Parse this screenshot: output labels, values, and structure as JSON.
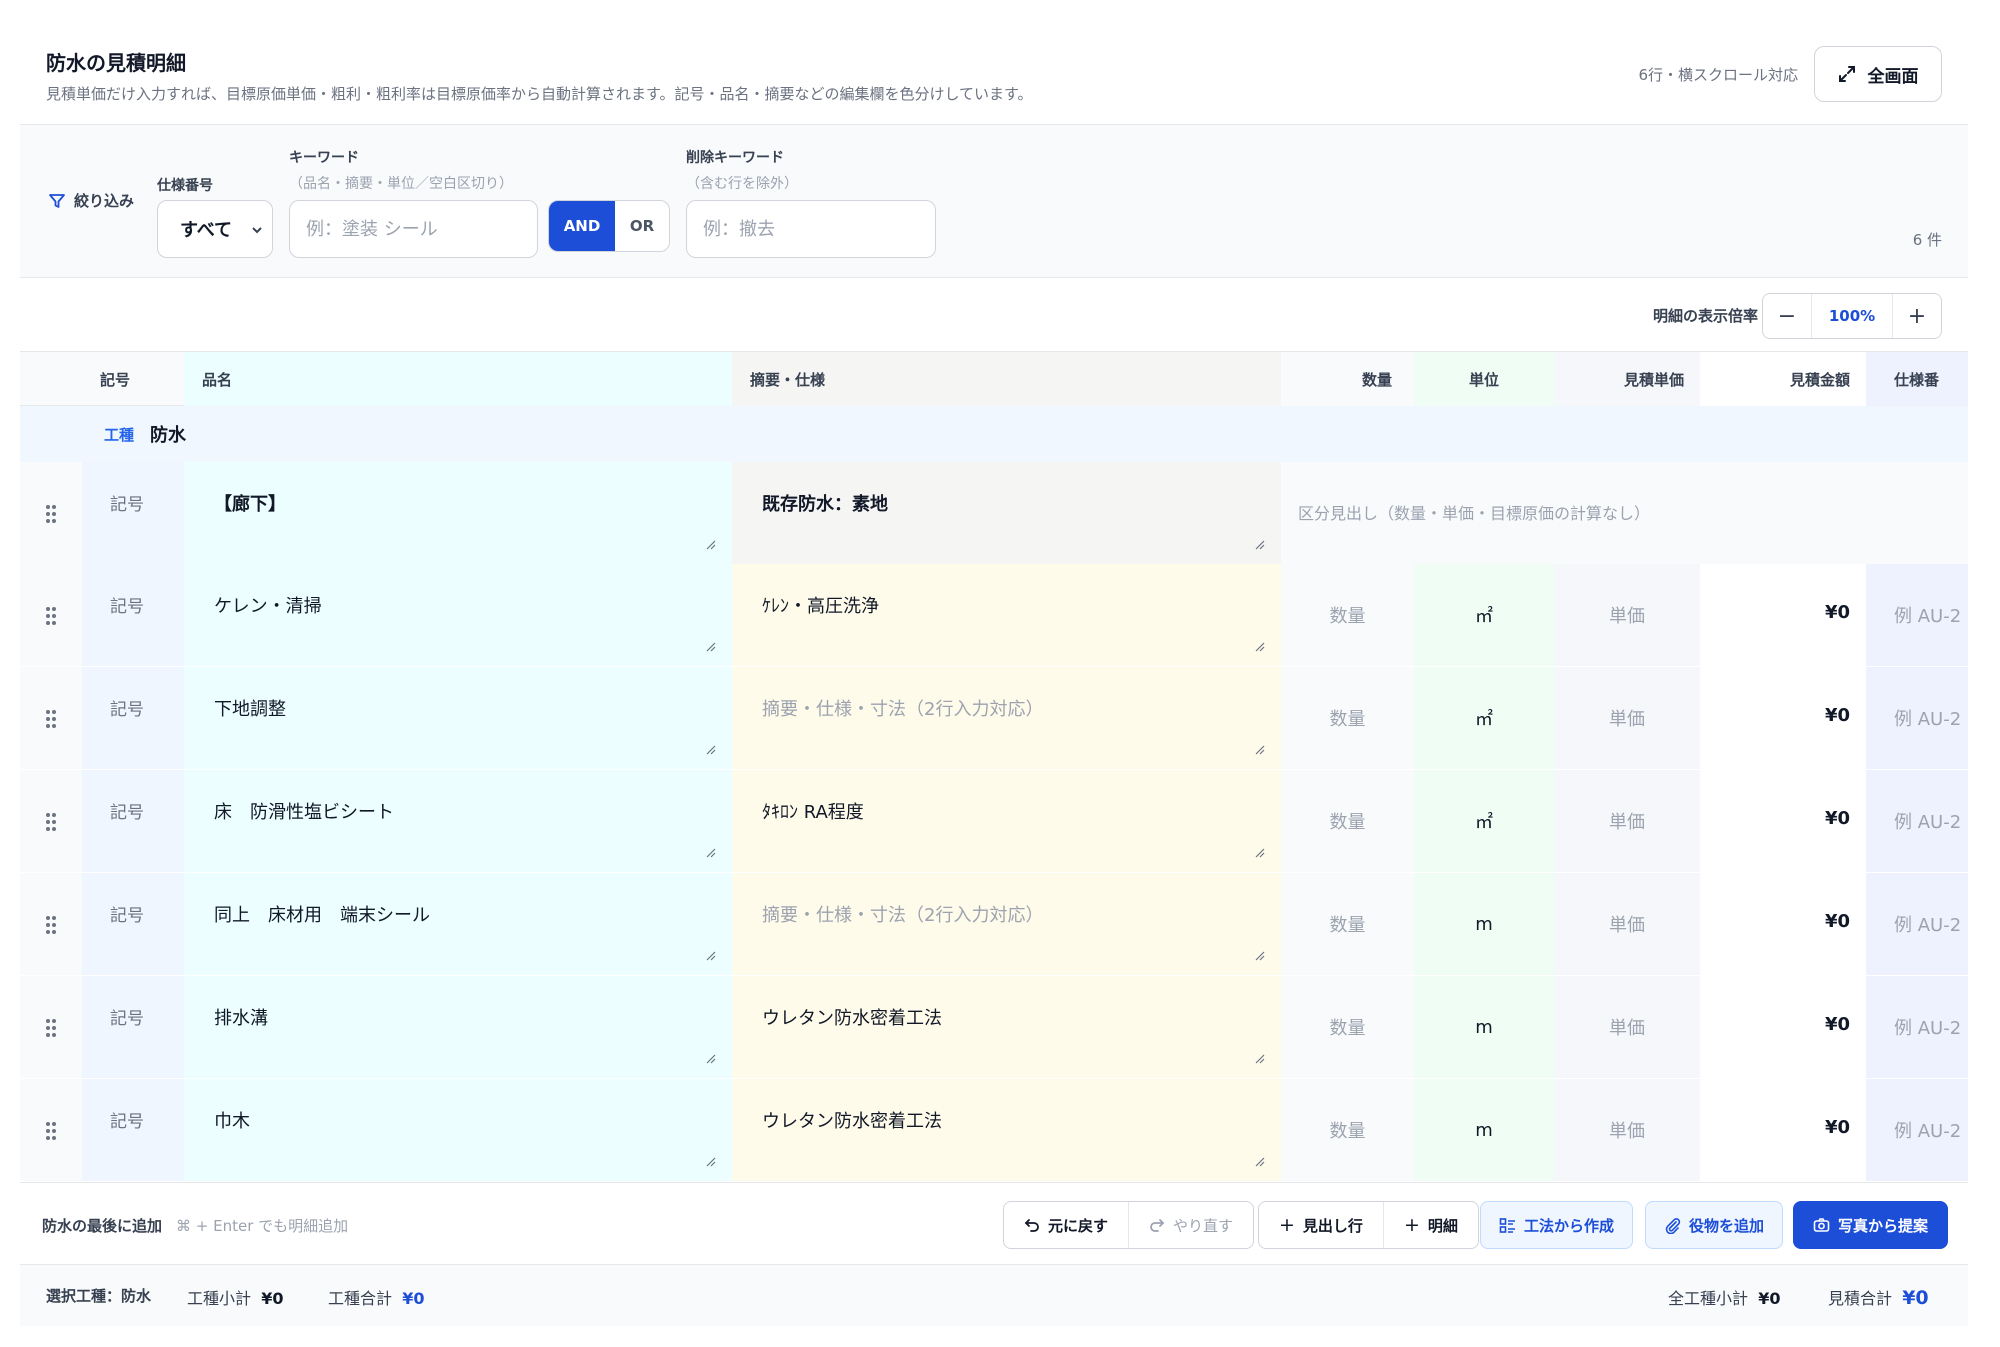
{
  "header": {
    "title": "防水の見積明細",
    "subtitle": "見積単価だけ入力すれば、目標原価単価・粗利・粗利率は目標原価率から自動計算されます。記号・品名・摘要などの編集欄を色分けしています。",
    "note": "6行・横スクロール対応",
    "fullscreen_label": "全画面"
  },
  "filter": {
    "label": "絞り込み",
    "spec_caption": "仕様番号",
    "spec_value": "すべて",
    "keyword_caption": "キーワード",
    "keyword_hint": "（品名・摘要・単位／空白区切り）",
    "keyword_placeholder": "例：塗装 シール",
    "and_label": "AND",
    "or_label": "OR",
    "exclude_caption": "削除キーワード",
    "exclude_hint": "（含む行を除外）",
    "exclude_placeholder": "例：撤去",
    "count": "6 件"
  },
  "zoom": {
    "label": "明細の表示倍率",
    "minus": "−",
    "value": "100%",
    "plus": "+"
  },
  "table": {
    "columns": {
      "code": "記号",
      "name": "品名",
      "memo": "摘要・仕様",
      "qty": "数量",
      "unit": "単位",
      "unit_price": "見積単価",
      "amount": "見積金額",
      "spec": "仕様番"
    },
    "group": {
      "tag": "工種",
      "name": "防水"
    },
    "heading_row": {
      "code": "記号",
      "name": "【廊下】",
      "memo": "既存防水：素地",
      "note": "区分見出し（数量・単価・目標原価の計算なし）"
    },
    "rows": [
      {
        "code": "記号",
        "name": "ケレン・清掃",
        "memo": "ｹﾚﾝ・高圧洗浄",
        "memo_placeholder": false,
        "qty": "数量",
        "unit": "㎡",
        "unit_price": "単価",
        "amount": "¥0",
        "spec": "例 AU-2"
      },
      {
        "code": "記号",
        "name": "下地調整",
        "memo": "摘要・仕様・寸法（2行入力対応）",
        "memo_placeholder": true,
        "qty": "数量",
        "unit": "㎡",
        "unit_price": "単価",
        "amount": "¥0",
        "spec": "例 AU-2"
      },
      {
        "code": "記号",
        "name": "床　防滑性塩ビシート",
        "memo": "ﾀｷﾛﾝ RA程度",
        "memo_placeholder": false,
        "qty": "数量",
        "unit": "㎡",
        "unit_price": "単価",
        "amount": "¥0",
        "spec": "例 AU-2"
      },
      {
        "code": "記号",
        "name": "同上　床材用　端末シール",
        "memo": "摘要・仕様・寸法（2行入力対応）",
        "memo_placeholder": true,
        "qty": "数量",
        "unit": "m",
        "unit_price": "単価",
        "amount": "¥0",
        "spec": "例 AU-2"
      },
      {
        "code": "記号",
        "name": "排水溝",
        "memo": "ウレタン防水密着工法",
        "memo_placeholder": false,
        "qty": "数量",
        "unit": "m",
        "unit_price": "単価",
        "amount": "¥0",
        "spec": "例 AU-2"
      },
      {
        "code": "記号",
        "name": "巾木",
        "memo": "ウレタン防水密着工法",
        "memo_placeholder": false,
        "qty": "数量",
        "unit": "m",
        "unit_price": "単価",
        "amount": "¥0",
        "spec": "例 AU-2"
      }
    ]
  },
  "actions": {
    "add_label": "防水の最後に追加",
    "add_hint": "⌘ + Enter でも明細追加",
    "undo": "元に戻す",
    "redo": "やり直す",
    "add_heading": "見出し行",
    "add_detail": "明細",
    "from_method": "工法から作成",
    "add_labor": "役物を追加",
    "from_photo": "写真から提案"
  },
  "footer": {
    "selected_label": "選択工種：防水",
    "sub_label": "工種小計",
    "sub_value": "¥0",
    "total_label": "工種合計",
    "total_value": "¥0",
    "all_sub_label": "全工種小計",
    "all_sub_value": "¥0",
    "estimate_label": "見積合計",
    "estimate_value": "¥0"
  },
  "colors": {
    "accent": "#1d4ed8",
    "name_col": "#ecfeff",
    "memo_col": "#fffbeb"
  }
}
